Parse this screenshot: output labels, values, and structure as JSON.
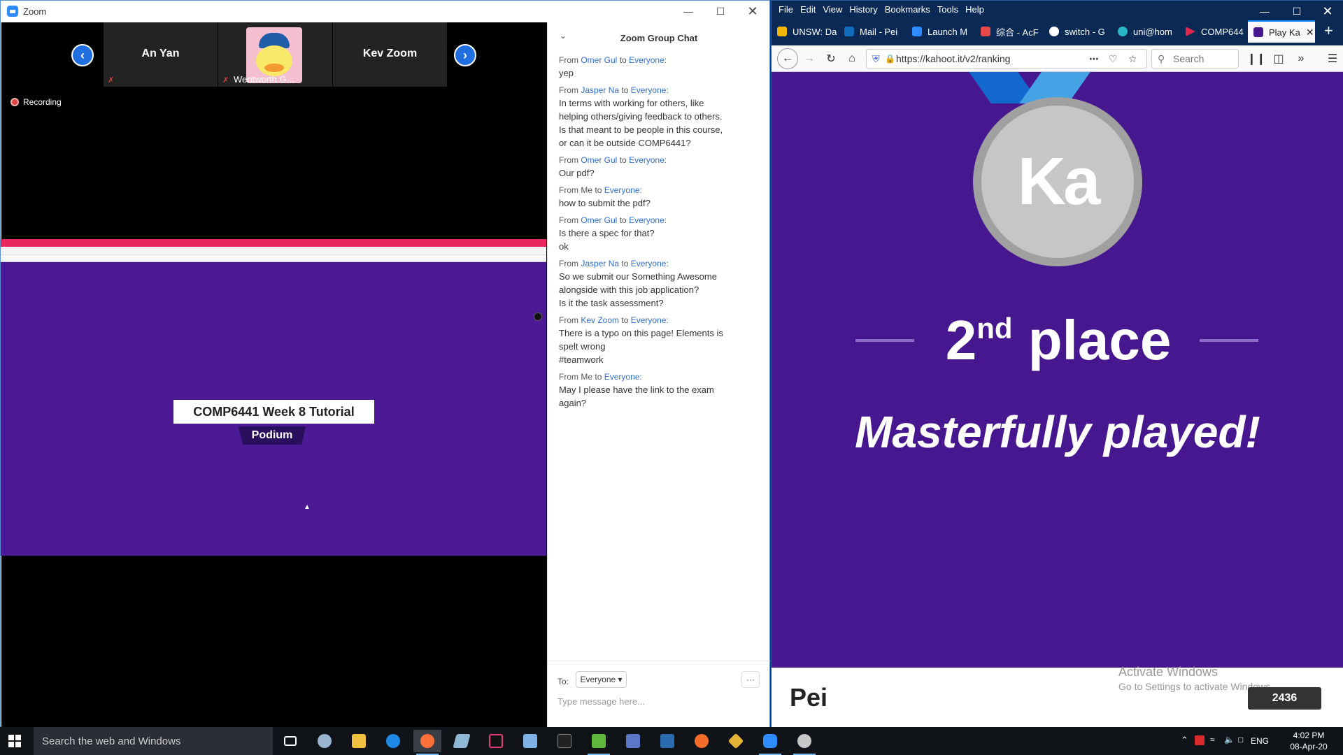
{
  "zoom": {
    "window_title": "Zoom",
    "participants": [
      {
        "name": "An Yan",
        "muted": true
      },
      {
        "name": "Wentworth G...",
        "muted": true,
        "has_video": true
      },
      {
        "name": "Kev Zoom",
        "muted": false
      }
    ],
    "recording_label": "Recording",
    "shared_screen": {
      "title": "COMP6441 Week 8 Tutorial",
      "subtitle": "Podium"
    },
    "chat": {
      "title": "Zoom Group Chat",
      "messages": [
        {
          "from": "Omer Gul",
          "to": "Everyone:",
          "text": "yep"
        },
        {
          "from": "Jasper Na",
          "to": "Everyone:",
          "text": "In terms with working for others, like\nhelping others/giving feedback to others.\nIs that meant to be people in this course,\nor can it be outside COMP6441?"
        },
        {
          "from": "Omer Gul",
          "to": "Everyone:",
          "text": "Our pdf?"
        },
        {
          "from": "Me",
          "to": "Everyone:",
          "text": "how to submit the pdf?"
        },
        {
          "from": "Omer Gul",
          "to": "Everyone:",
          "text": "Is there a spec for that?\nok"
        },
        {
          "from": "Jasper Na",
          "to": "Everyone:",
          "text": "So we submit our Something Awesome\nalongside with this job application?\nIs it the task assessment?"
        },
        {
          "from": "Kev Zoom",
          "to": "Everyone:",
          "text": "There is a typo on this page! Elements is\nspelt wrong\n#teamwork"
        },
        {
          "from": "Me",
          "to": "Everyone:",
          "text": "May I please have the link to the exam\nagain?"
        }
      ],
      "from_word": "From",
      "to_word": "to",
      "to_label": "To:",
      "recipient": "Everyone",
      "more_label": "···",
      "input_placeholder": "Type message here..."
    }
  },
  "firefox": {
    "menu": [
      "File",
      "Edit",
      "View",
      "History",
      "Bookmarks",
      "Tools",
      "Help"
    ],
    "tabs": [
      {
        "label": "UNSW: Da",
        "color": "#f2b705"
      },
      {
        "label": "Mail - Pei",
        "color": "#0f6cbd"
      },
      {
        "label": "Launch M",
        "color": "#2d8cff"
      },
      {
        "label": "综合 - AcF",
        "color": "#e8484a"
      },
      {
        "label": "switch - G",
        "color": "#ffffff"
      },
      {
        "label": "uni@hom",
        "color": "#29b6c6"
      },
      {
        "label": "COMP644",
        "color": "#e2264d"
      },
      {
        "label": "Play Ka",
        "color": "#46178f",
        "active": true
      }
    ],
    "url": "https://kahoot.it/v2/ranking",
    "search_placeholder": "Search",
    "medal_text": "Ka",
    "place_number": "2",
    "place_suffix": "nd",
    "place_word": "place",
    "praise": "Masterfully played!",
    "player_name": "Pei",
    "score": "2436",
    "watermark_line1": "Activate Windows",
    "watermark_line2": "Go to Settings to activate Windows."
  },
  "taskbar": {
    "search_placeholder": "Search the web and Windows",
    "language": "ENG",
    "time": "4:02 PM",
    "date": "08-Apr-20"
  }
}
